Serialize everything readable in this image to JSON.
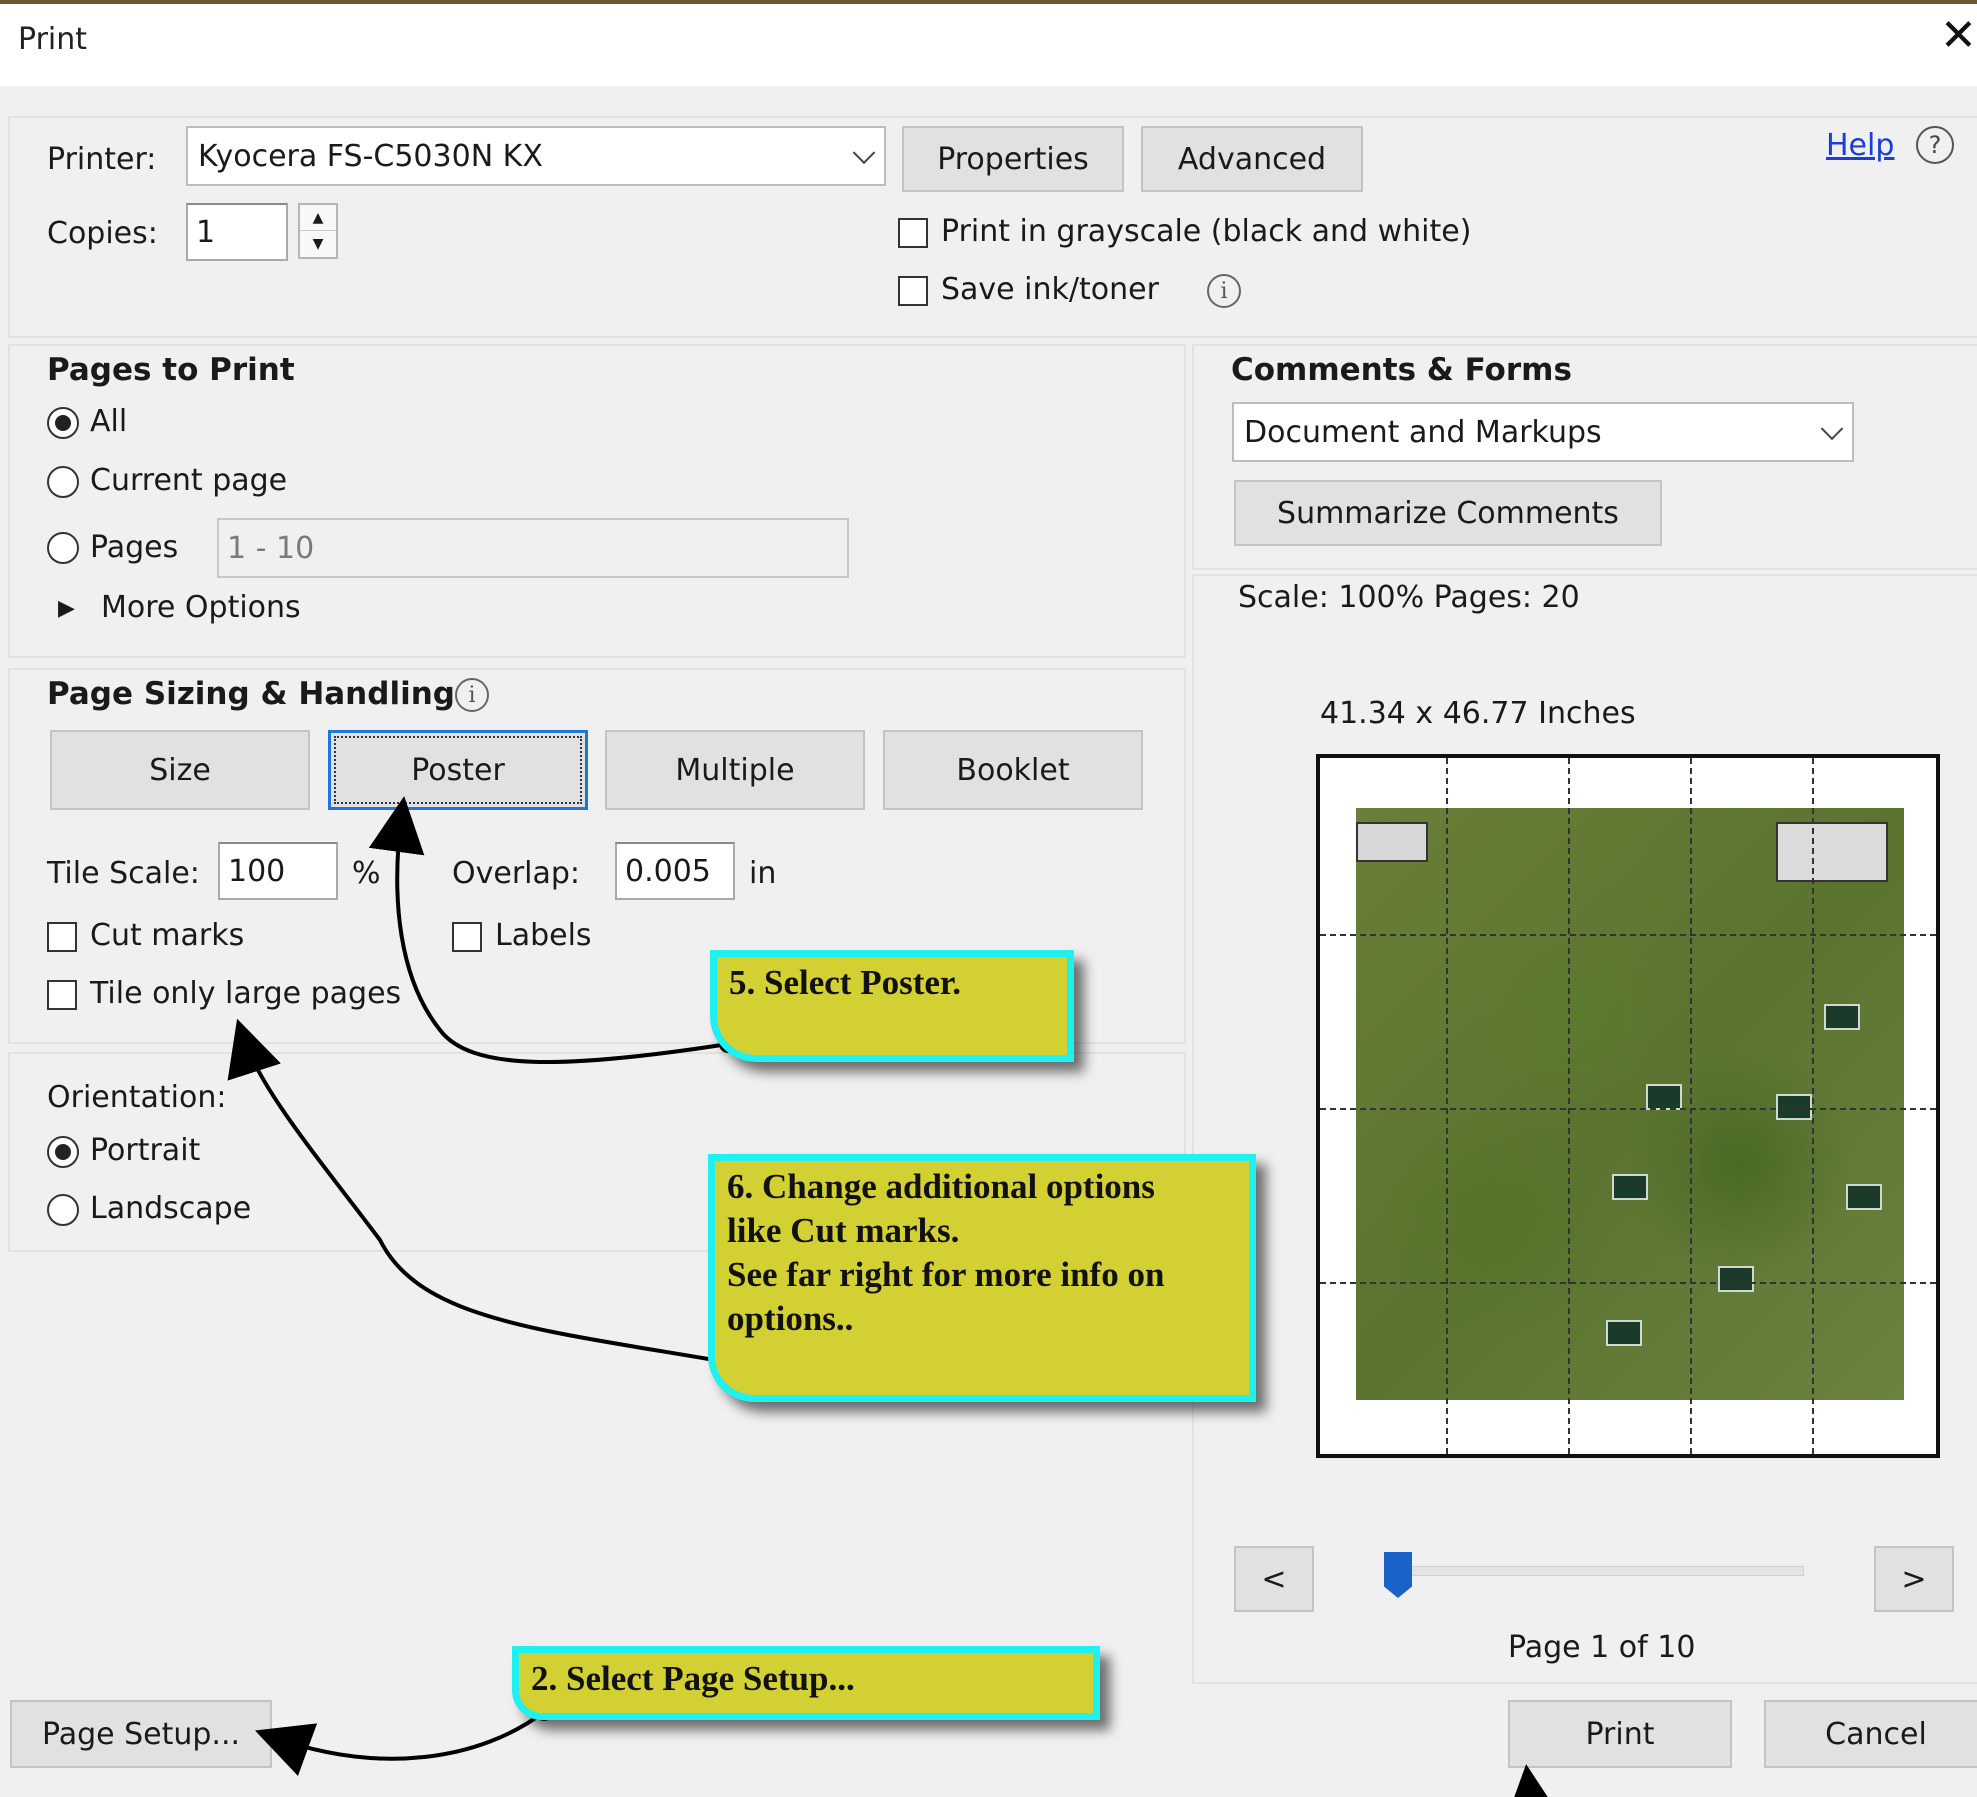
{
  "window": {
    "title": "Print"
  },
  "printer": {
    "label": "Printer:",
    "value": "Kyocera FS-C5030N KX",
    "properties_label": "Properties",
    "advanced_label": "Advanced",
    "help_label": "Help"
  },
  "copies": {
    "label": "Copies:",
    "value": "1"
  },
  "options": {
    "grayscale_label": "Print in grayscale (black and white)",
    "grayscale_checked": false,
    "save_ink_label": "Save ink/toner",
    "save_ink_checked": false
  },
  "pages_to_print": {
    "title": "Pages to Print",
    "all_label": "All",
    "current_label": "Current page",
    "pages_label": "Pages",
    "pages_value": "1 - 10",
    "more_options_label": "More Options",
    "selected": "All"
  },
  "sizing": {
    "title": "Page Sizing & Handling",
    "buttons": [
      "Size",
      "Poster",
      "Multiple",
      "Booklet"
    ],
    "selected": "Poster",
    "tile_scale_label": "Tile Scale:",
    "tile_scale_value": "100",
    "tile_scale_unit": "%",
    "overlap_label": "Overlap:",
    "overlap_value": "0.005",
    "overlap_unit": "in",
    "cut_marks_label": "Cut marks",
    "labels_label": "Labels",
    "tile_large_label": "Tile only large pages"
  },
  "orientation": {
    "title": "Orientation:",
    "portrait_label": "Portrait",
    "landscape_label": "Landscape",
    "selected": "Portrait"
  },
  "comments": {
    "title": "Comments & Forms",
    "value": "Document and Markups",
    "summarize_label": "Summarize Comments"
  },
  "preview": {
    "scale_text": "Scale: 100% Pages: 20",
    "size_text": "41.34 x 46.77 Inches",
    "prev_label": "<",
    "next_label": ">",
    "page_text": "Page 1 of 10",
    "slider_position": 0
  },
  "footer": {
    "page_setup_label": "Page Setup...",
    "print_label": "Print",
    "cancel_label": "Cancel"
  },
  "callouts": {
    "step5": "5. Select Poster.",
    "step6_line1": "6. Change additional options",
    "step6_line2": "like Cut marks.",
    "step6_line3": "See far right for more info on",
    "step6_line4": "options..",
    "step2": "2. Select Page Setup..."
  },
  "colors": {
    "callout_fill": "#d2d032",
    "callout_border": "#1ff0f0",
    "accent": "#1a78d8"
  }
}
